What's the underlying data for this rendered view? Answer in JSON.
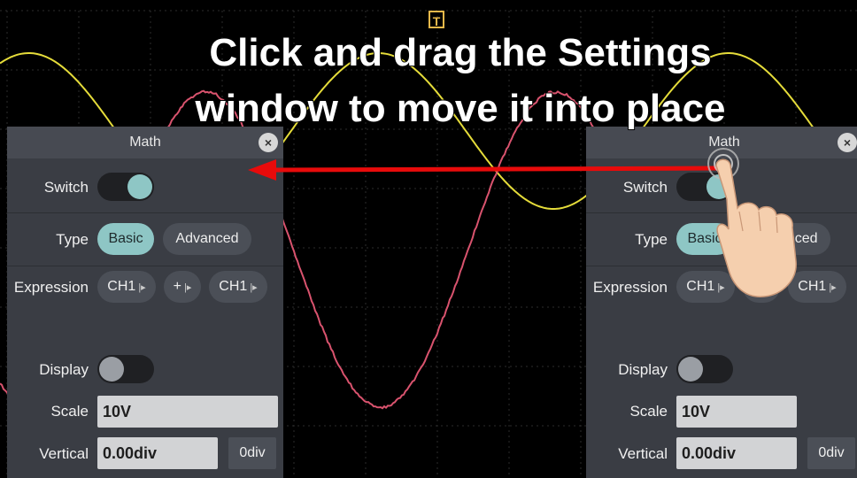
{
  "caption": {
    "line1": "Click and drag the Settings",
    "line2": "window to move it into place"
  },
  "trigger_marker": "T",
  "panel": {
    "title": "Math",
    "close_glyph": "×",
    "switch_label": "Switch",
    "type_label": "Type",
    "type_options": [
      "Basic",
      "Advanced"
    ],
    "expression_label": "Expression",
    "expression": {
      "source1": "CH1",
      "operator": "+",
      "source2": "CH1",
      "dropdown_glyph": "|▸"
    },
    "display_label": "Display",
    "scale_label": "Scale",
    "scale_value": "10V",
    "vertical_label": "Vertical",
    "vertical_value": "0.00div",
    "vertical_button": "0div"
  },
  "colors": {
    "ch1_trace": "#e5dc3a",
    "math_trace": "#d9536e",
    "panel_bg": "#3a3d44",
    "accent": "#8ec6c5",
    "arrow": "#e80b0b"
  },
  "icons": [
    "close-icon",
    "hand-pointer-icon",
    "drag-arrow-icon",
    "trigger-marker-icon"
  ]
}
